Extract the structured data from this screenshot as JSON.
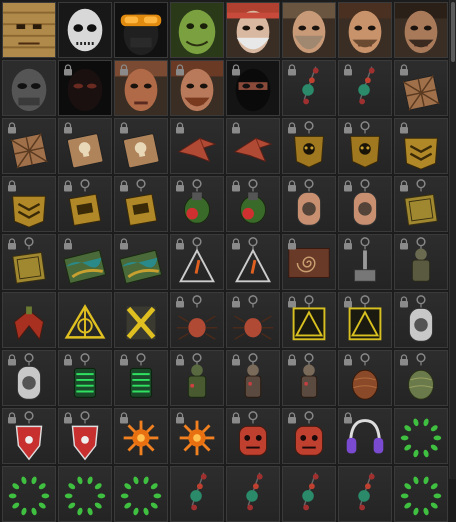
{
  "inventory": {
    "columns": 8,
    "items": [
      {
        "icon": "scarecrow-mask-icon",
        "locked": false
      },
      {
        "icon": "skull-mask-icon",
        "locked": false
      },
      {
        "icon": "orange-goggles-mask-icon",
        "locked": false
      },
      {
        "icon": "green-monster-mask-icon",
        "locked": false
      },
      {
        "icon": "bandana-old-man-face-icon",
        "locked": false
      },
      {
        "icon": "bearded-man-face-icon",
        "locked": false
      },
      {
        "icon": "brown-haired-man-face-icon",
        "locked": false
      },
      {
        "icon": "dark-haired-man-face-icon",
        "locked": false
      },
      {
        "icon": "gray-balaclava-face-icon",
        "locked": false
      },
      {
        "icon": "dark-hooded-face-icon",
        "locked": true
      },
      {
        "icon": "bald-man-face-icon",
        "locked": true
      },
      {
        "icon": "red-beard-face-icon",
        "locked": true
      },
      {
        "icon": "black-mask-face-icon",
        "locked": true
      },
      {
        "icon": "bead-keychain-icon",
        "locked": true
      },
      {
        "icon": "bead-keychain-icon",
        "locked": true
      },
      {
        "icon": "sunburst-tile-charm-icon",
        "locked": true
      },
      {
        "icon": "sunburst-tile-charm-icon",
        "locked": true
      },
      {
        "icon": "skull-card-charm-icon",
        "locked": true
      },
      {
        "icon": "skull-card-charm-icon",
        "locked": true
      },
      {
        "icon": "origami-bird-charm-icon",
        "locked": true
      },
      {
        "icon": "origami-bird-charm-icon",
        "locked": true
      },
      {
        "icon": "gold-skull-badge-icon",
        "locked": true
      },
      {
        "icon": "gold-skull-badge-icon",
        "locked": true
      },
      {
        "icon": "gold-chevron-badge-icon",
        "locked": true
      },
      {
        "icon": "gold-chevron-badge-icon",
        "locked": true
      },
      {
        "icon": "gold-logo-badge-icon",
        "locked": true
      },
      {
        "icon": "gold-logo-badge-icon",
        "locked": true
      },
      {
        "icon": "green-grenade-charm-icon",
        "locked": true
      },
      {
        "icon": "green-grenade-charm-icon",
        "locked": true
      },
      {
        "icon": "copper-dog-tag-icon",
        "locked": true
      },
      {
        "icon": "copper-dog-tag-icon",
        "locked": true
      },
      {
        "icon": "gold-plate-charm-icon",
        "locked": true
      },
      {
        "icon": "gold-plate-charm-icon",
        "locked": true
      },
      {
        "icon": "camo-card-charm-icon",
        "locked": true
      },
      {
        "icon": "camo-card-charm-icon",
        "locked": true
      },
      {
        "icon": "triangle-warning-charm-icon",
        "locked": true
      },
      {
        "icon": "triangle-warning-charm-icon",
        "locked": true
      },
      {
        "icon": "spiral-card-charm-icon",
        "locked": true
      },
      {
        "icon": "hammer-charm-icon",
        "locked": true
      },
      {
        "icon": "soldier-figure-charm-icon",
        "locked": true
      },
      {
        "icon": "red-wings-charm-icon",
        "locked": false
      },
      {
        "icon": "yellow-triangle-sigil-icon",
        "locked": false
      },
      {
        "icon": "yellow-x-charm-icon",
        "locked": false
      },
      {
        "icon": "red-spider-charm-icon",
        "locked": true
      },
      {
        "icon": "red-spider-charm-icon",
        "locked": true
      },
      {
        "icon": "yellow-zone-sign-icon",
        "locked": true
      },
      {
        "icon": "yellow-zone-sign-icon",
        "locked": true
      },
      {
        "icon": "silver-dog-tag-icon",
        "locked": true
      },
      {
        "icon": "silver-dog-tag-icon",
        "locked": true
      },
      {
        "icon": "green-lantern-charm-icon",
        "locked": true
      },
      {
        "icon": "green-lantern-charm-icon",
        "locked": true
      },
      {
        "icon": "green-soldier-figure-icon",
        "locked": true
      },
      {
        "icon": "skeleton-figure-charm-icon",
        "locked": true
      },
      {
        "icon": "skeleton-figure-charm-icon",
        "locked": true
      },
      {
        "icon": "brown-egg-charm-icon",
        "locked": true
      },
      {
        "icon": "green-egg-charm-icon",
        "locked": true
      },
      {
        "icon": "red-shield-charm-icon",
        "locked": true
      },
      {
        "icon": "red-shield-charm-icon",
        "locked": true
      },
      {
        "icon": "orange-sun-charm-icon",
        "locked": true
      },
      {
        "icon": "orange-sun-charm-icon",
        "locked": true
      },
      {
        "icon": "red-face-charm-icon",
        "locked": true
      },
      {
        "icon": "red-face-charm-icon",
        "locked": true
      },
      {
        "icon": "purple-headphones-charm-icon",
        "locked": true
      },
      {
        "icon": "green-dot-ring-icon",
        "locked": false
      },
      {
        "icon": "green-dot-ring-icon",
        "locked": false
      },
      {
        "icon": "green-dot-ring-icon",
        "locked": false
      },
      {
        "icon": "green-dot-ring-icon",
        "locked": false
      },
      {
        "icon": "bead-keychain-icon",
        "locked": false
      },
      {
        "icon": "bead-keychain-icon",
        "locked": false
      },
      {
        "icon": "bead-keychain-icon",
        "locked": false
      },
      {
        "icon": "bead-keychain-icon",
        "locked": false
      },
      {
        "icon": "green-dot-ring-icon",
        "locked": false
      }
    ]
  },
  "colors": {
    "cell_bg": "#262626",
    "cell_border": "#3a3a3a",
    "lock": "#8a8a8a"
  }
}
